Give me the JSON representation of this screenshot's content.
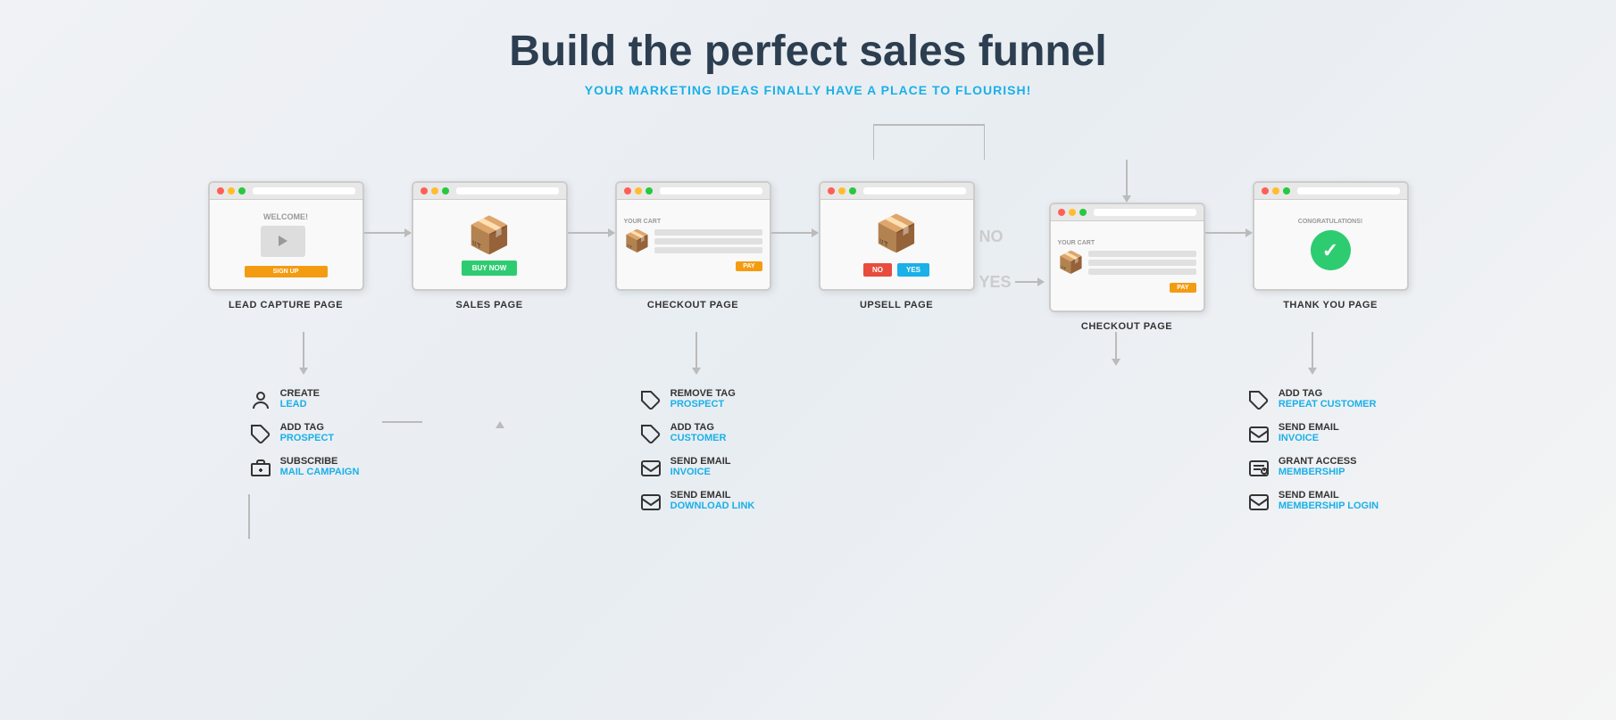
{
  "header": {
    "title": "Build the perfect sales funnel",
    "subtitle": "YOUR MARKETING IDEAS FINALLY HAVE A PLACE TO FLOURISH!"
  },
  "steps": [
    {
      "id": "lead-capture",
      "label": "LEAD CAPTURE PAGE",
      "type": "lead-capture"
    },
    {
      "id": "sales",
      "label": "SALES PAGE",
      "type": "sales"
    },
    {
      "id": "checkout1",
      "label": "CHECKOUT PAGE",
      "type": "checkout"
    },
    {
      "id": "upsell",
      "label": "UPSELL PAGE",
      "type": "upsell"
    },
    {
      "id": "checkout2",
      "label": "CHECKOUT PAGE",
      "type": "checkout"
    },
    {
      "id": "thankyou",
      "label": "THANK YOU PAGE",
      "type": "thankyou"
    }
  ],
  "actions": {
    "lead_capture": [
      {
        "icon": "person-icon",
        "label": "CREATE",
        "value": "LEAD"
      },
      {
        "icon": "tag-icon",
        "label": "ADD TAG",
        "value": "PROSPECT"
      },
      {
        "icon": "mail-icon",
        "label": "SUBSCRIBE",
        "value": "MAIL CAMPAIGN"
      }
    ],
    "checkout1": [
      {
        "icon": "tag-icon",
        "label": "REMOVE TAG",
        "value": "PROSPECT"
      },
      {
        "icon": "tag-icon",
        "label": "ADD TAG",
        "value": "CUSTOMER"
      },
      {
        "icon": "email-icon",
        "label": "SEND EMAIL",
        "value": "INVOICE"
      },
      {
        "icon": "email-icon",
        "label": "SEND EMAIL",
        "value": "DOWNLOAD LINK"
      }
    ],
    "thankyou": [
      {
        "icon": "tag-icon",
        "label": "ADD TAG",
        "value": "REPEAT CUSTOMER"
      },
      {
        "icon": "email-icon",
        "label": "SEND EMAIL",
        "value": "INVOICE"
      },
      {
        "icon": "member-icon",
        "label": "GRANT ACCESS",
        "value": "MEMBERSHIP"
      },
      {
        "icon": "email-icon",
        "label": "SEND EMAIL",
        "value": "MEMBERSHIP LOGIN"
      }
    ]
  },
  "branch_labels": {
    "no": "NO",
    "yes": "YES"
  },
  "colors": {
    "accent": "#1ab0e8",
    "green": "#2ecc71",
    "orange": "#f39c12",
    "red": "#e74c3c",
    "arrow": "#bbbbbb",
    "text_dark": "#2c3e50",
    "text_label": "#333333"
  }
}
